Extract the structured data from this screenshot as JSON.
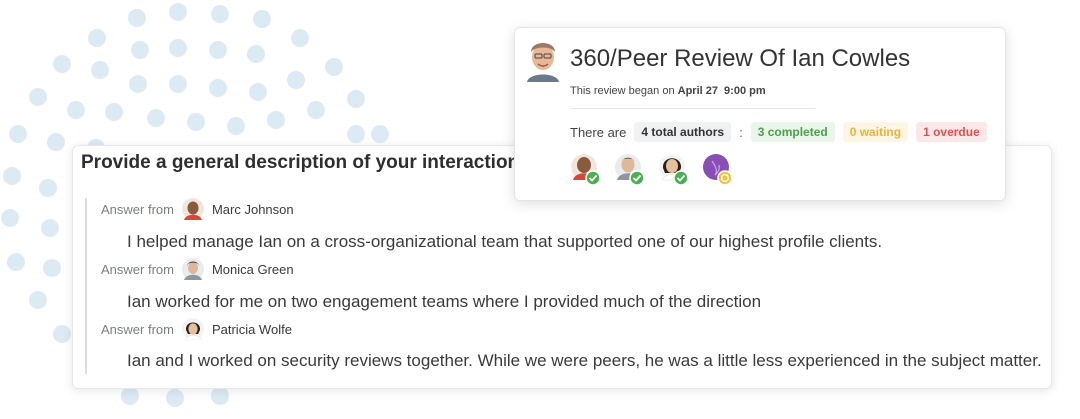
{
  "colors": {
    "dots": "#dceaf4",
    "completed": "#4caf50",
    "waiting": "#f4c040",
    "overdue": "#d9534f"
  },
  "review": {
    "title": "360/Peer Review Of Ian Cowles",
    "began_prefix": "This review began on",
    "began_date": "April 27",
    "began_time": "9:00 pm",
    "there_are": "There are",
    "total_authors": "4 total authors",
    "colon": ":",
    "completed": "3 completed",
    "waiting": "0 waiting",
    "overdue": "1 overdue",
    "authors": [
      {
        "status": "completed",
        "icon": "check-badge-icon"
      },
      {
        "status": "completed",
        "icon": "check-badge-icon"
      },
      {
        "status": "completed",
        "icon": "check-badge-icon"
      },
      {
        "status": "waiting",
        "icon": "clock-badge-icon"
      }
    ]
  },
  "question": {
    "text": "Provide a general description of your interaction"
  },
  "answers": [
    {
      "label": "Answer from",
      "author": "Marc Johnson",
      "text": "I helped manage Ian on a cross-organizational team that supported one of our highest profile clients."
    },
    {
      "label": "Answer from",
      "author": "Monica Green",
      "text": "Ian worked for me on two engagement teams where I provided much of the direction"
    },
    {
      "label": "Answer from",
      "author": "Patricia Wolfe",
      "text": "Ian and I worked on security reviews together. While we were peers, he was a little less experienced in the subject matter."
    }
  ]
}
